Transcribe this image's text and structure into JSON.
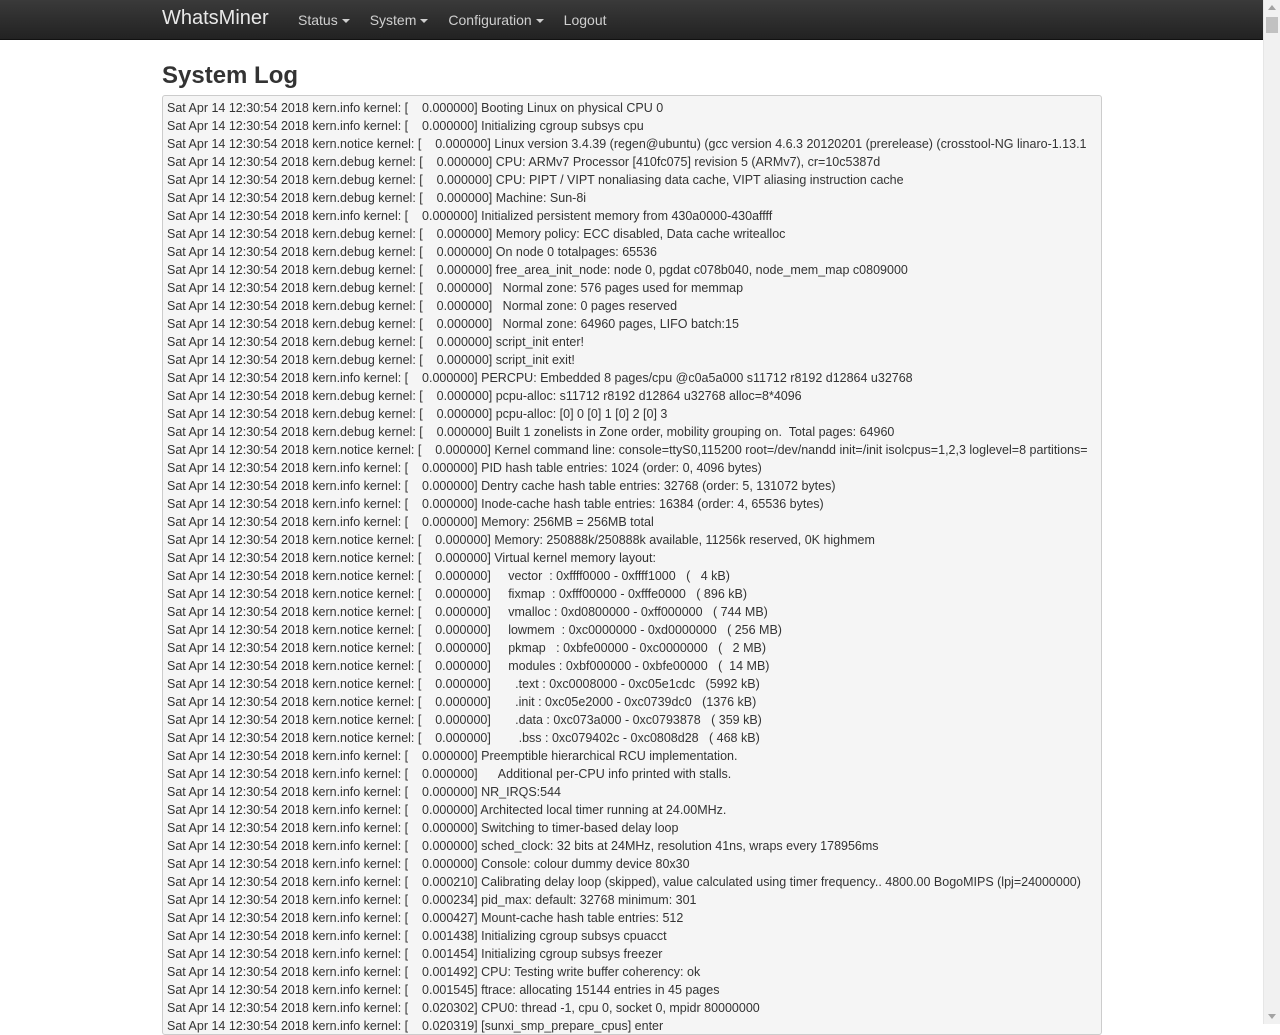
{
  "navbar": {
    "brand": "WhatsMiner",
    "menu": [
      {
        "label": "Status",
        "dropdown": true
      },
      {
        "label": "System",
        "dropdown": true
      },
      {
        "label": "Configuration",
        "dropdown": true
      },
      {
        "label": "Logout",
        "dropdown": false
      }
    ]
  },
  "page": {
    "title": "System Log"
  },
  "log_lines": [
    "Sat Apr 14 12:30:54 2018 kern.info kernel: [    0.000000] Booting Linux on physical CPU 0",
    "Sat Apr 14 12:30:54 2018 kern.info kernel: [    0.000000] Initializing cgroup subsys cpu",
    "Sat Apr 14 12:30:54 2018 kern.notice kernel: [    0.000000] Linux version 3.4.39 (regen@ubuntu) (gcc version 4.6.3 20120201 (prerelease) (crosstool-NG linaro-1.13.1",
    "Sat Apr 14 12:30:54 2018 kern.debug kernel: [    0.000000] CPU: ARMv7 Processor [410fc075] revision 5 (ARMv7), cr=10c5387d",
    "Sat Apr 14 12:30:54 2018 kern.debug kernel: [    0.000000] CPU: PIPT / VIPT nonaliasing data cache, VIPT aliasing instruction cache",
    "Sat Apr 14 12:30:54 2018 kern.debug kernel: [    0.000000] Machine: Sun-8i",
    "Sat Apr 14 12:30:54 2018 kern.info kernel: [    0.000000] Initialized persistent memory from 430a0000-430affff",
    "Sat Apr 14 12:30:54 2018 kern.debug kernel: [    0.000000] Memory policy: ECC disabled, Data cache writealloc",
    "Sat Apr 14 12:30:54 2018 kern.debug kernel: [    0.000000] On node 0 totalpages: 65536",
    "Sat Apr 14 12:30:54 2018 kern.debug kernel: [    0.000000] free_area_init_node: node 0, pgdat c078b040, node_mem_map c0809000",
    "Sat Apr 14 12:30:54 2018 kern.debug kernel: [    0.000000]   Normal zone: 576 pages used for memmap",
    "Sat Apr 14 12:30:54 2018 kern.debug kernel: [    0.000000]   Normal zone: 0 pages reserved",
    "Sat Apr 14 12:30:54 2018 kern.debug kernel: [    0.000000]   Normal zone: 64960 pages, LIFO batch:15",
    "Sat Apr 14 12:30:54 2018 kern.debug kernel: [    0.000000] script_init enter!",
    "Sat Apr 14 12:30:54 2018 kern.debug kernel: [    0.000000] script_init exit!",
    "Sat Apr 14 12:30:54 2018 kern.info kernel: [    0.000000] PERCPU: Embedded 8 pages/cpu @c0a5a000 s11712 r8192 d12864 u32768",
    "Sat Apr 14 12:30:54 2018 kern.debug kernel: [    0.000000] pcpu-alloc: s11712 r8192 d12864 u32768 alloc=8*4096",
    "Sat Apr 14 12:30:54 2018 kern.debug kernel: [    0.000000] pcpu-alloc: [0] 0 [0] 1 [0] 2 [0] 3",
    "Sat Apr 14 12:30:54 2018 kern.debug kernel: [    0.000000] Built 1 zonelists in Zone order, mobility grouping on.  Total pages: 64960",
    "Sat Apr 14 12:30:54 2018 kern.notice kernel: [    0.000000] Kernel command line: console=ttyS0,115200 root=/dev/nandd init=/init isolcpus=1,2,3 loglevel=8 partitions=",
    "Sat Apr 14 12:30:54 2018 kern.info kernel: [    0.000000] PID hash table entries: 1024 (order: 0, 4096 bytes)",
    "Sat Apr 14 12:30:54 2018 kern.info kernel: [    0.000000] Dentry cache hash table entries: 32768 (order: 5, 131072 bytes)",
    "Sat Apr 14 12:30:54 2018 kern.info kernel: [    0.000000] Inode-cache hash table entries: 16384 (order: 4, 65536 bytes)",
    "Sat Apr 14 12:30:54 2018 kern.info kernel: [    0.000000] Memory: 256MB = 256MB total",
    "Sat Apr 14 12:30:54 2018 kern.notice kernel: [    0.000000] Memory: 250888k/250888k available, 11256k reserved, 0K highmem",
    "Sat Apr 14 12:30:54 2018 kern.notice kernel: [    0.000000] Virtual kernel memory layout:",
    "Sat Apr 14 12:30:54 2018 kern.notice kernel: [    0.000000]     vector  : 0xffff0000 - 0xffff1000   (   4 kB)",
    "Sat Apr 14 12:30:54 2018 kern.notice kernel: [    0.000000]     fixmap  : 0xfff00000 - 0xfffe0000   ( 896 kB)",
    "Sat Apr 14 12:30:54 2018 kern.notice kernel: [    0.000000]     vmalloc : 0xd0800000 - 0xff000000   ( 744 MB)",
    "Sat Apr 14 12:30:54 2018 kern.notice kernel: [    0.000000]     lowmem  : 0xc0000000 - 0xd0000000   ( 256 MB)",
    "Sat Apr 14 12:30:54 2018 kern.notice kernel: [    0.000000]     pkmap   : 0xbfe00000 - 0xc0000000   (   2 MB)",
    "Sat Apr 14 12:30:54 2018 kern.notice kernel: [    0.000000]     modules : 0xbf000000 - 0xbfe00000   (  14 MB)",
    "Sat Apr 14 12:30:54 2018 kern.notice kernel: [    0.000000]       .text : 0xc0008000 - 0xc05e1cdc   (5992 kB)",
    "Sat Apr 14 12:30:54 2018 kern.notice kernel: [    0.000000]       .init : 0xc05e2000 - 0xc0739dc0   (1376 kB)",
    "Sat Apr 14 12:30:54 2018 kern.notice kernel: [    0.000000]       .data : 0xc073a000 - 0xc0793878   ( 359 kB)",
    "Sat Apr 14 12:30:54 2018 kern.notice kernel: [    0.000000]        .bss : 0xc079402c - 0xc0808d28   ( 468 kB)",
    "Sat Apr 14 12:30:54 2018 kern.info kernel: [    0.000000] Preemptible hierarchical RCU implementation.",
    "Sat Apr 14 12:30:54 2018 kern.info kernel: [    0.000000]      Additional per-CPU info printed with stalls.",
    "Sat Apr 14 12:30:54 2018 kern.info kernel: [    0.000000] NR_IRQS:544",
    "Sat Apr 14 12:30:54 2018 kern.info kernel: [    0.000000] Architected local timer running at 24.00MHz.",
    "Sat Apr 14 12:30:54 2018 kern.info kernel: [    0.000000] Switching to timer-based delay loop",
    "Sat Apr 14 12:30:54 2018 kern.info kernel: [    0.000000] sched_clock: 32 bits at 24MHz, resolution 41ns, wraps every 178956ms",
    "Sat Apr 14 12:30:54 2018 kern.info kernel: [    0.000000] Console: colour dummy device 80x30",
    "Sat Apr 14 12:30:54 2018 kern.info kernel: [    0.000210] Calibrating delay loop (skipped), value calculated using timer frequency.. 4800.00 BogoMIPS (lpj=24000000)",
    "Sat Apr 14 12:30:54 2018 kern.info kernel: [    0.000234] pid_max: default: 32768 minimum: 301",
    "Sat Apr 14 12:30:54 2018 kern.info kernel: [    0.000427] Mount-cache hash table entries: 512",
    "Sat Apr 14 12:30:54 2018 kern.info kernel: [    0.001438] Initializing cgroup subsys cpuacct",
    "Sat Apr 14 12:30:54 2018 kern.info kernel: [    0.001454] Initializing cgroup subsys freezer",
    "Sat Apr 14 12:30:54 2018 kern.info kernel: [    0.001492] CPU: Testing write buffer coherency: ok",
    "Sat Apr 14 12:30:54 2018 kern.info kernel: [    0.001545] ftrace: allocating 15144 entries in 45 pages",
    "Sat Apr 14 12:30:54 2018 kern.info kernel: [    0.020302] CPU0: thread -1, cpu 0, socket 0, mpidr 80000000",
    "Sat Apr 14 12:30:54 2018 kern.info kernel: [    0.020319] [sunxi_smp_prepare_cpus] enter"
  ]
}
